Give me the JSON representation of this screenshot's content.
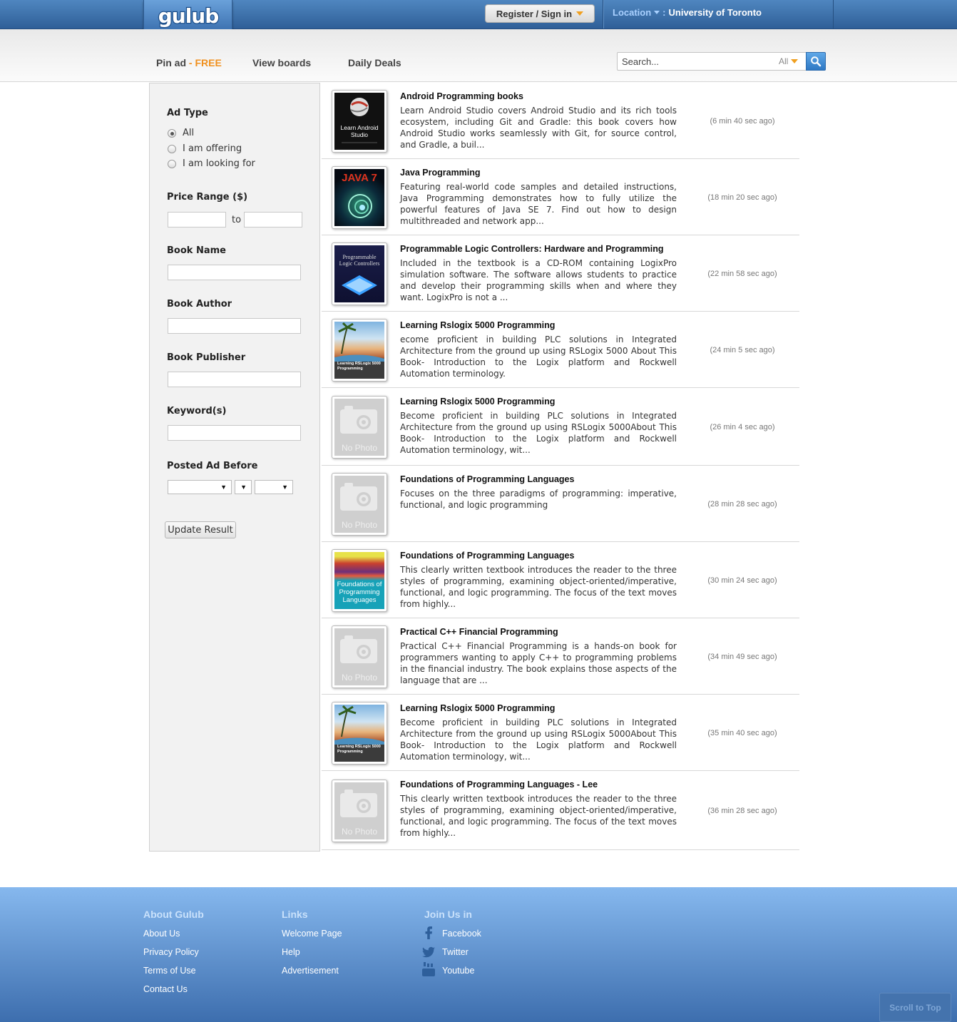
{
  "header": {
    "logo_text": "gulub",
    "register_label": "Register / Sign in",
    "location_label": "Location",
    "location_value": "University of Toronto"
  },
  "nav": {
    "pin_ad": "Pin ad",
    "pin_ad_free": " - FREE",
    "view_boards": "View boards",
    "daily_deals": "Daily Deals",
    "search_placeholder": "Search...",
    "search_scope": "All"
  },
  "filters": {
    "ad_type_heading": "Ad Type",
    "ad_type_options": [
      "All",
      "I am offering",
      "I am looking for"
    ],
    "ad_type_selected": "All",
    "price_heading": "Price Range ($)",
    "price_to": "to",
    "book_name_heading": "Book Name",
    "book_author_heading": "Book Author",
    "book_publisher_heading": "Book Publisher",
    "keywords_heading": "Keyword(s)",
    "posted_before_heading": "Posted Ad Before",
    "update_button": "Update Result"
  },
  "listings": [
    {
      "title": "Android Programming books",
      "description": "Learn Android Studio covers Android Studio and its rich tools ecosystem, including Git and Gradle: this book covers how Android Studio works seamlessly with Git, for source control, and Gradle, a buil...",
      "posted": "(6 min 40 sec ago)",
      "thumb": "android",
      "thumb_text": "Learn Android Studio"
    },
    {
      "title": "Java Programming",
      "description": "Featuring real-world code samples and detailed instructions, Java Programming demonstrates how to fully utilize the powerful features of Java SE 7. Find out how to design multithreaded and network app...",
      "posted": "(18 min 20 sec ago)",
      "thumb": "java",
      "thumb_text": "JAVA 7"
    },
    {
      "title": "Programmable Logic Controllers: Hardware and Programming",
      "description": "Included in the textbook is a CD-ROM containing LogixPro simulation software. The software allows students to practice and develop their programming skills when and where they want. LogixPro is not a ...",
      "posted": "(22 min 58 sec ago)",
      "thumb": "plc",
      "thumb_text": "Programmable Logic Controllers"
    },
    {
      "title": "Learning Rslogix 5000 Programming",
      "description": "ecome proficient in building PLC solutions in Integrated Architecture from the ground up using RSLogix 5000 About This Book- Introduction to the Logix platform and Rockwell Automation terminology.",
      "posted": "(24 min 5 sec ago)",
      "thumb": "beach",
      "thumb_text": "Learning RSLogix 5000 Programming"
    },
    {
      "title": "Learning Rslogix 5000 Programming",
      "description": "Become proficient in building PLC solutions in Integrated Architecture from the ground up using RSLogix 5000About This Book- Introduction to the Logix platform and Rockwell Automation terminology, wit...",
      "posted": "(26 min 4 sec ago)",
      "thumb": "nophoto",
      "thumb_text": "No Photo"
    },
    {
      "title": "Foundations of Programming Languages",
      "description": "Focuses on the three paradigms of programming: imperative, functional, and logic programming",
      "posted": "(28 min 28 sec ago)",
      "thumb": "nophoto",
      "thumb_text": "No Photo"
    },
    {
      "title": "Foundations of Programming Languages",
      "description": "This clearly written textbook introduces the reader to the three styles of programming, examining object-oriented/imperative, functional, and logic programming. The focus of the text moves from highly...",
      "posted": "(30 min 24 sec ago)",
      "thumb": "fopl",
      "thumb_text": "Foundations of Programming Languages"
    },
    {
      "title": "Practical C++ Financial Programming",
      "description": "Practical C++ Financial Programming is a hands-on book for programmers wanting to apply C++ to programming problems in the financial industry. The book explains those aspects of the language that are ...",
      "posted": "(34 min 49 sec ago)",
      "thumb": "nophoto",
      "thumb_text": "No Photo"
    },
    {
      "title": "Learning Rslogix 5000 Programming",
      "description": "Become proficient in building PLC solutions in Integrated Architecture from the ground up using RSLogix 5000About This Book- Introduction to the Logix platform and Rockwell Automation terminology, wit...",
      "posted": "(35 min 40 sec ago)",
      "thumb": "beach",
      "thumb_text": "Learning RSLogix 5000 Programming"
    },
    {
      "title": "Foundations of Programming Languages - Lee",
      "description": "This clearly written textbook introduces the reader to the three styles of programming, examining object-oriented/imperative, functional, and logic programming. The focus of the text moves from highly...",
      "posted": "(36 min 28 sec ago)",
      "thumb": "nophoto",
      "thumb_text": "No Photo"
    }
  ],
  "footer": {
    "about_heading": "About Gulub",
    "about_links": [
      "About Us",
      "Privacy Policy",
      "Terms of Use",
      "Contact Us"
    ],
    "links_heading": "Links",
    "links": [
      "Welcome Page",
      "Help",
      "Advertisement"
    ],
    "join_heading": "Join Us in",
    "social": [
      {
        "label": "Facebook",
        "icon": "facebook-icon"
      },
      {
        "label": "Twitter",
        "icon": "twitter-icon"
      },
      {
        "label": "Youtube",
        "icon": "youtube-icon"
      }
    ],
    "scroll_top": "Scroll to Top"
  },
  "colors": {
    "accent_orange": "#f0901e",
    "brand_blue": "#2f5f98",
    "footer_blue": "#5b8fcf"
  }
}
